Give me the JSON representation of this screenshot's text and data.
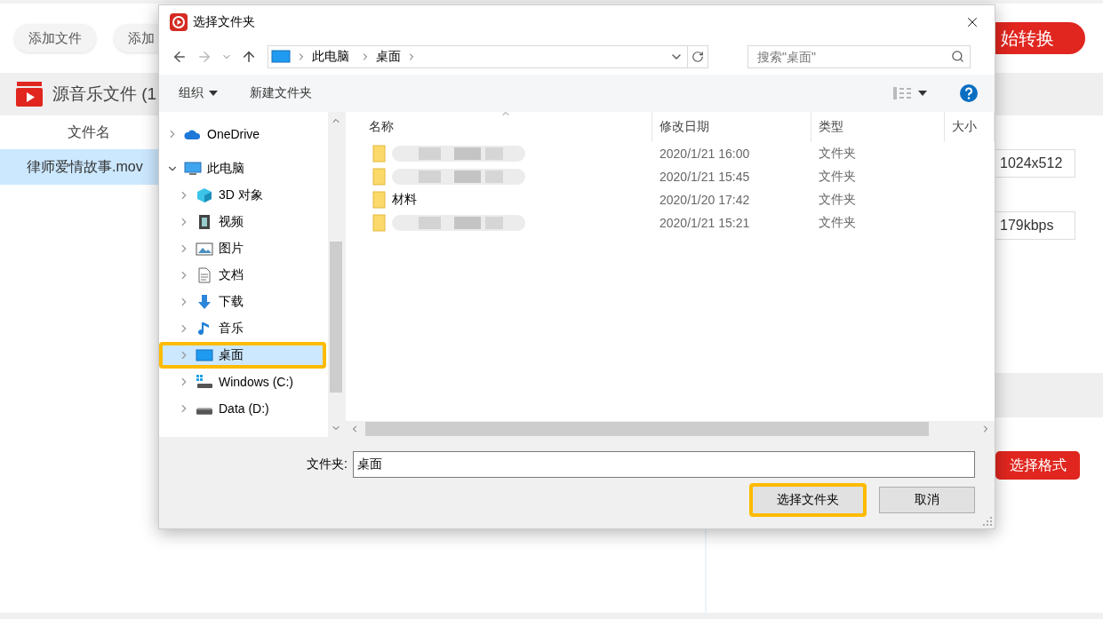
{
  "app": {
    "toolbar": {
      "buttons": [
        "添加文件",
        "添加"
      ],
      "start_button": "始转换"
    },
    "source_panel": {
      "title": "源音乐文件 (1",
      "column": "文件名",
      "rows": [
        {
          "name": "律师爱情故事.mov",
          "selected": true
        }
      ]
    },
    "settings": {
      "fields": [
        "1024x512",
        "179kbps"
      ],
      "format_button": "选择格式"
    }
  },
  "dialog": {
    "title": "选择文件夹",
    "breadcrumb": [
      "此电脑",
      "桌面"
    ],
    "search": {
      "placeholder": "搜索\"桌面\""
    },
    "toolbar": {
      "organize": "组织",
      "new_folder": "新建文件夹"
    },
    "nav": [
      {
        "label": "OneDrive",
        "kind": "cloud",
        "expanded": false,
        "selected": false,
        "highlighted": false
      },
      {
        "label": "此电脑",
        "kind": "computer",
        "expanded": true,
        "selected": false,
        "highlighted": false,
        "children": [
          {
            "label": "3D 对象",
            "kind": "cube",
            "expanded": false,
            "selected": false,
            "highlighted": false
          },
          {
            "label": "视频",
            "kind": "film",
            "expanded": false,
            "selected": false,
            "highlighted": false
          },
          {
            "label": "图片",
            "kind": "image",
            "expanded": false,
            "selected": false,
            "highlighted": false
          },
          {
            "label": "文档",
            "kind": "document",
            "expanded": false,
            "selected": false,
            "highlighted": false
          },
          {
            "label": "下载",
            "kind": "download",
            "expanded": false,
            "selected": false,
            "highlighted": false
          },
          {
            "label": "音乐",
            "kind": "music",
            "expanded": false,
            "selected": false,
            "highlighted": false
          },
          {
            "label": "桌面",
            "kind": "monitor",
            "expanded": false,
            "selected": true,
            "highlighted": true
          },
          {
            "label": "Windows (C:)",
            "kind": "system-drive",
            "expanded": false,
            "selected": false,
            "highlighted": false
          },
          {
            "label": "Data (D:)",
            "kind": "drive",
            "expanded": false,
            "selected": false,
            "highlighted": false
          }
        ]
      }
    ],
    "columns": [
      {
        "label": "名称",
        "sorted": true
      },
      {
        "label": "修改日期",
        "sorted": false
      },
      {
        "label": "类型",
        "sorted": false
      },
      {
        "label": "大小",
        "sorted": false
      }
    ],
    "files": [
      {
        "redacted": true,
        "date": "2020/1/21 16:00",
        "type": "文件夹"
      },
      {
        "redacted": true,
        "date": "2020/1/21 15:45",
        "type": "文件夹"
      },
      {
        "redacted": false,
        "name": "材料",
        "date": "2020/1/20 17:42",
        "type": "文件夹"
      },
      {
        "redacted": true,
        "date": "2020/1/21 15:21",
        "type": "文件夹"
      }
    ],
    "folder_label": "文件夹:",
    "folder_value": "桌面",
    "buttons": [
      {
        "label": "选择文件夹",
        "highlighted": true
      },
      {
        "label": "取消",
        "highlighted": false
      }
    ]
  }
}
